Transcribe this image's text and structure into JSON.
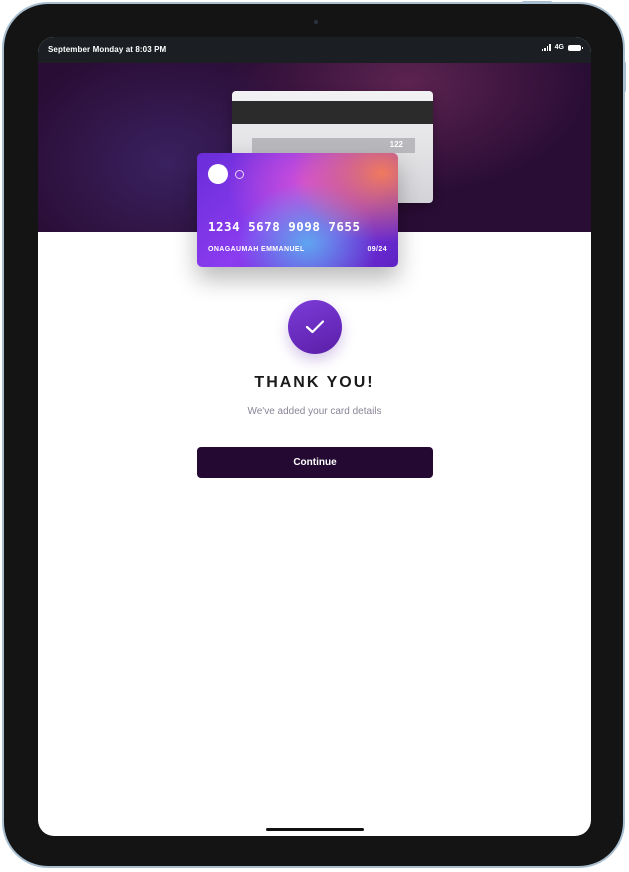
{
  "status_bar": {
    "time_text": "September Monday at 8:03 PM",
    "network": "4G",
    "signal_icon": "signal-bars-icon",
    "battery_icon": "battery-icon"
  },
  "card_back": {
    "cvv": "122"
  },
  "card_front": {
    "number": "1234 5678 9098 7655",
    "holder": "ONAGAUMAH EMMANUEL",
    "expiry": "09/24"
  },
  "success": {
    "icon": "checkmark-icon",
    "title": "THANK YOU!",
    "subtitle": "We've added your card details"
  },
  "actions": {
    "continue_label": "Continue"
  },
  "colors": {
    "primary": "#240a32",
    "accent": "#6a2cd8",
    "hero_bg": "#2a0d35"
  }
}
